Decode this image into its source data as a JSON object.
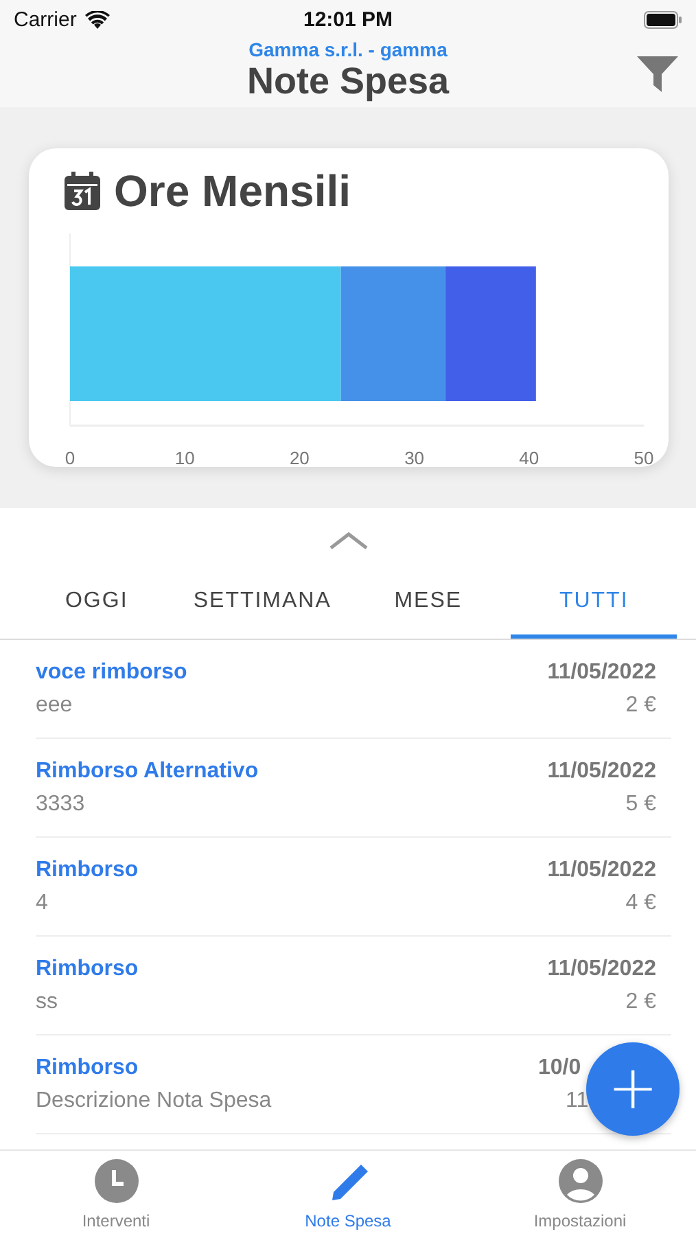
{
  "status_bar": {
    "carrier": "Carrier",
    "time": "12:01 PM"
  },
  "header": {
    "subtitle": "Gamma s.r.l. - gamma",
    "title": "Note Spesa"
  },
  "card": {
    "title": "Ore Mensili",
    "chart_data": {
      "type": "bar",
      "orientation": "horizontal",
      "stacked": true,
      "series": [
        {
          "color": "#4ac8ef",
          "values": [
            23.6
          ]
        },
        {
          "color": "#4590e8",
          "values": [
            9.1
          ]
        },
        {
          "color": "#425fe9",
          "values": [
            7.9
          ]
        }
      ],
      "xlim": [
        0,
        50
      ],
      "xticks": [
        0,
        10,
        20,
        30,
        40,
        50
      ]
    }
  },
  "tabs": [
    {
      "label": "OGGI",
      "selected": false
    },
    {
      "label": "SETTIMANA",
      "selected": false
    },
    {
      "label": "MESE",
      "selected": false
    },
    {
      "label": "TUTTI",
      "selected": true
    }
  ],
  "items": [
    {
      "kind": "entry",
      "title": "voce rimborso",
      "description": "eee",
      "date": "11/05/2022",
      "amount": "2 €"
    },
    {
      "kind": "entry",
      "title": "Rimborso Alternativo",
      "description": "3333",
      "date": "11/05/2022",
      "amount": "5 €"
    },
    {
      "kind": "entry",
      "title": "Rimborso",
      "description": "4",
      "date": "11/05/2022",
      "amount": "4 €"
    },
    {
      "kind": "entry",
      "title": "Rimborso",
      "description": "ss",
      "date": "11/05/2022",
      "amount": "2 €"
    },
    {
      "kind": "covered",
      "title": "Rimborso",
      "description": "Descrizione Nota Spesa",
      "date": "10/0",
      "amount": "11"
    }
  ],
  "fab": {
    "label": "+"
  },
  "tab_bar": [
    {
      "label": "Interventi",
      "kind": "clock",
      "selected": false
    },
    {
      "label": "Note Spesa",
      "kind": "pencil",
      "selected": true
    },
    {
      "label": "Impostazioni",
      "kind": "person",
      "selected": false
    }
  ]
}
